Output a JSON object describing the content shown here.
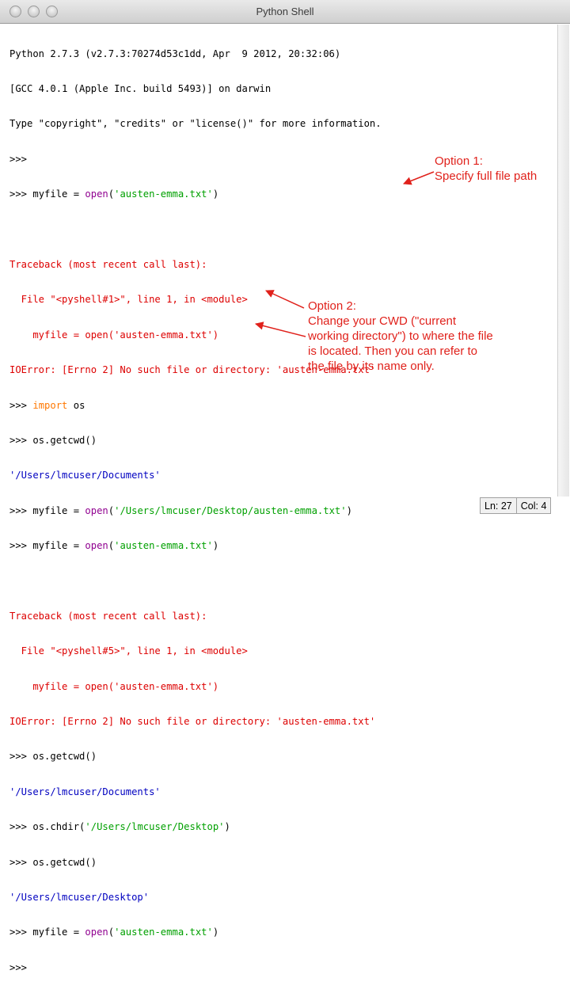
{
  "window": {
    "title": "Python Shell"
  },
  "shell": {
    "header": [
      "Python 2.7.3 (v2.7.3:70274d53c1dd, Apr  9 2012, 20:32:06)",
      "[GCC 4.0.1 (Apple Inc. build 5493)] on darwin",
      "Type \"copyright\", \"credits\" or \"license()\" for more information."
    ],
    "prompt": ">>> ",
    "cmd_open_pre": "myfile = ",
    "builtin_open": "open",
    "arg_emma": "'austen-emma.txt'",
    "tb_header": "Traceback (most recent call last):",
    "tb_file_1": "  File \"<pyshell#1>\", line 1, in <module>",
    "tb_file_5": "  File \"<pyshell#5>\", line 1, in <module>",
    "tb_code": "    myfile = open('austen-emma.txt')",
    "ioerror": "IOError: [Errno 2] No such file or directory: 'austen-emma.txt'",
    "kw_import": "import",
    "import_mod": " os",
    "getcwd": "os.getcwd()",
    "out_documents": "'/Users/lmcuser/Documents'",
    "arg_full_path": "'/Users/lmcuser/Desktop/austen-emma.txt'",
    "chdir_pre": "os.chdir(",
    "arg_desktop": "'/Users/lmcuser/Desktop'",
    "out_desktop": "'/Users/lmcuser/Desktop'"
  },
  "annotations": {
    "option1": [
      "Option 1:",
      "Specify full file path"
    ],
    "option2": [
      "Option 2:",
      "Change your CWD (\"current",
      "working directory\") to where the file",
      "is located. Then you can refer to",
      "the file by its name only."
    ]
  },
  "status": {
    "line": "Ln: 27",
    "col": "Col: 4"
  },
  "colors": {
    "error": "#dd0000",
    "string": "#00a000",
    "output": "#0000c0",
    "keyword": "#ff7700",
    "builtin": "#900090",
    "annotation": "#e0211b"
  }
}
